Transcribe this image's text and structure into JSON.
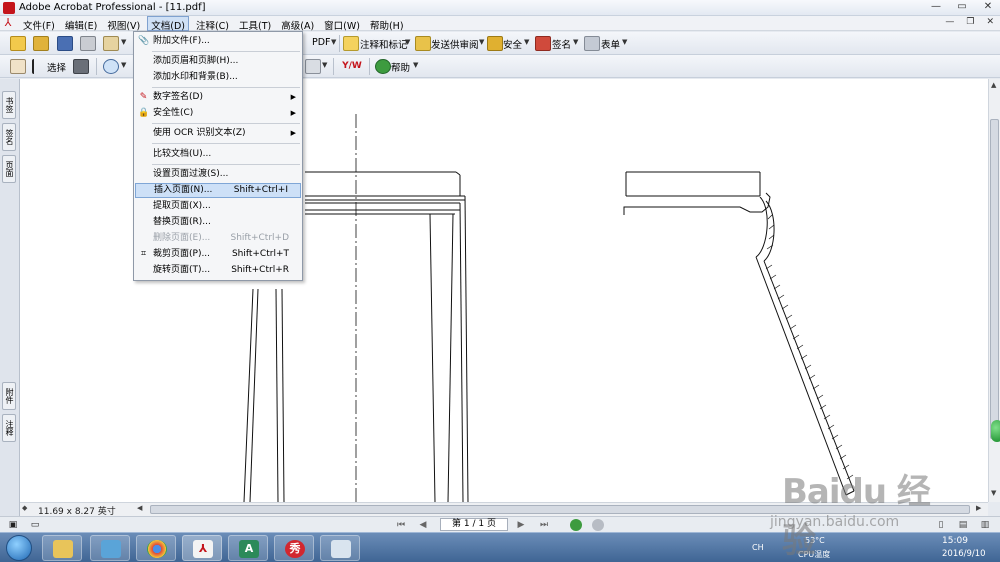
{
  "window": {
    "title": "Adobe Acrobat Professional - [11.pdf]",
    "minimize": "—",
    "maximize": "▭",
    "close": "✕"
  },
  "menubar": {
    "items": [
      "文件(F)",
      "编辑(E)",
      "视图(V)",
      "文档(D)",
      "注释(C)",
      "工具(T)",
      "高级(A)",
      "窗口(W)",
      "帮助(H)"
    ],
    "active_index": 3
  },
  "toolbar1": {
    "create_pdf": "PDF",
    "comment_markup": "注释和标记",
    "send_review": "发送供审阅",
    "secure": "安全",
    "sign": "签名",
    "forms": "表单"
  },
  "toolbar2": {
    "select": "选择",
    "help": "帮助"
  },
  "side_panel": {
    "tabs": [
      "书签",
      "签名",
      "页面",
      "附件",
      "注释"
    ]
  },
  "document_menu": {
    "items": [
      {
        "label": "附加文件(F)...",
        "shortcut": "",
        "icon": "paperclip-icon",
        "submenu": false,
        "disabled": false
      },
      {
        "label": "添加页眉和页脚(H)...",
        "shortcut": "",
        "icon": "",
        "submenu": false,
        "disabled": false
      },
      {
        "label": "添加水印和背景(B)...",
        "shortcut": "",
        "icon": "",
        "submenu": false,
        "disabled": false
      },
      {
        "label": "数字签名(D)",
        "shortcut": "",
        "icon": "pen-icon",
        "submenu": true,
        "disabled": false
      },
      {
        "label": "安全性(C)",
        "shortcut": "",
        "icon": "lock-icon",
        "submenu": true,
        "disabled": false
      },
      {
        "label": "使用 OCR 识别文本(Z)",
        "shortcut": "",
        "icon": "",
        "submenu": true,
        "disabled": false
      },
      {
        "label": "比较文档(U)...",
        "shortcut": "",
        "icon": "",
        "submenu": false,
        "disabled": false
      },
      {
        "label": "设置页面过渡(S)...",
        "shortcut": "",
        "icon": "",
        "submenu": false,
        "disabled": false
      },
      {
        "label": "插入页面(N)...",
        "shortcut": "Shift+Ctrl+I",
        "icon": "",
        "submenu": false,
        "disabled": false,
        "highlighted": true
      },
      {
        "label": "提取页面(X)...",
        "shortcut": "",
        "icon": "",
        "submenu": false,
        "disabled": false
      },
      {
        "label": "替换页面(R)...",
        "shortcut": "",
        "icon": "",
        "submenu": false,
        "disabled": false
      },
      {
        "label": "删除页面(E)...",
        "shortcut": "Shift+Ctrl+D",
        "icon": "",
        "submenu": false,
        "disabled": true
      },
      {
        "label": "裁剪页面(P)...",
        "shortcut": "Shift+Ctrl+T",
        "icon": "crop-icon",
        "submenu": false,
        "disabled": false
      },
      {
        "label": "旋转页面(T)...",
        "shortcut": "Shift+Ctrl+R",
        "icon": "",
        "submenu": false,
        "disabled": false
      }
    ]
  },
  "status": {
    "page_size": "11.69 x 8.27 英寸",
    "page_indicator": "第 1 / 1 页"
  },
  "taskbar": {
    "ime": "CH",
    "temperature": "53°C",
    "cpu_label": "CPU温度",
    "time": "15:09",
    "date": "2016/9/10"
  },
  "watermark": {
    "brand": "Baidu 经验",
    "url": "jingyan.baidu.com"
  },
  "colors": {
    "menu_highlight": "#cde0f7",
    "acrobat_red": "#c4141b",
    "taskbar": "#3f6594"
  }
}
